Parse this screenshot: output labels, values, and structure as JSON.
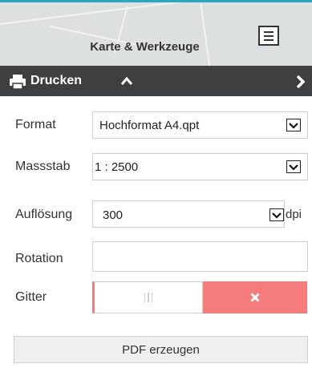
{
  "header": {
    "title": "Karte & Werkzeuge",
    "menu_icon": "hamburger-menu-icon"
  },
  "panel": {
    "title": "Drucken",
    "print_icon": "printer-icon",
    "collapse_icon": "chevron-up-icon",
    "next_icon": "chevron-right-icon",
    "header_color": "#3d3f41"
  },
  "form": {
    "format": {
      "label": "Format",
      "value": "Hochformat A4.qpt"
    },
    "scale": {
      "label": "Massstab",
      "value": "1 :  2500"
    },
    "resolution": {
      "label": "Auflösung",
      "value": "300",
      "unit": "dpi"
    },
    "rotation": {
      "label": "Rotation",
      "value": ""
    },
    "grid": {
      "label": "Gitter",
      "state": "off",
      "grip_icon": "grip-icon",
      "off_icon": "close-icon",
      "active_color": "#f47c7c"
    }
  },
  "actions": {
    "pdf_label": "PDF erzeugen"
  }
}
